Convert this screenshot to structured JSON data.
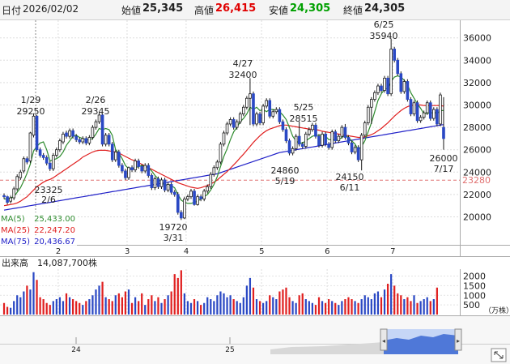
{
  "header": {
    "date_label": "日付",
    "date": "2026/02/02",
    "open_label": "始値",
    "open": "25,345",
    "high_label": "高値",
    "high": "26,415",
    "low_label": "安値",
    "low": "24,305",
    "close_label": "終値",
    "close": "24,305"
  },
  "colors": {
    "up": "#2a48c4",
    "down": "#2a48c4",
    "ma5": "#2e8b2e",
    "ma25": "#e02020",
    "ma75": "#2020c8",
    "vol_up": "#2a48c4",
    "vol_down": "#e02020",
    "high_value": "#e00000",
    "low_value": "#00a000",
    "ref_line": "#e07070"
  },
  "legend": {
    "ma5": "MA(5)",
    "ma5_value": "25,433.00",
    "ma25": "MA(25)",
    "ma25_value": "22,247.20",
    "ma75": "MA(75)",
    "ma75_value": "20,436.67"
  },
  "volume_header": {
    "label": "出来高",
    "value": "14,087,700株"
  },
  "volume_unit": "（万株）",
  "ref_price_label": "23280",
  "nav_labels": [
    "24",
    "25"
  ],
  "chart_data": {
    "type": "candlestick",
    "x_month_labels": [
      "2",
      "3",
      "4",
      "5",
      "6",
      "7"
    ],
    "price_axis": {
      "ylim": [
        17500,
        37500
      ],
      "ticks": [
        20000,
        22000,
        24000,
        26000,
        28000,
        30000,
        32000,
        34000,
        36000
      ]
    },
    "volume_axis": {
      "ylim": [
        0,
        2400
      ],
      "ticks": [
        500,
        1000,
        1500,
        2000
      ]
    },
    "reference_price": 23280,
    "annotations": [
      {
        "date": "1/29",
        "value": 29250
      },
      {
        "date": "2/6",
        "value": 23325
      },
      {
        "date": "2/26",
        "value": 29345
      },
      {
        "date": "3/31",
        "value": 19720
      },
      {
        "date": "4/27",
        "value": 32400
      },
      {
        "date": "5/19",
        "value": 24860
      },
      {
        "date": "5/25",
        "value": 28515
      },
      {
        "date": "6/11",
        "value": 24150
      },
      {
        "date": "6/25",
        "value": 35940
      },
      {
        "date": "7/17",
        "value": 26000
      }
    ],
    "month_boundaries": [
      17,
      38,
      56,
      79,
      99,
      119
    ],
    "closes": [
      21800,
      21300,
      21700,
      22500,
      23600,
      24000,
      25200,
      24900,
      27500,
      29000,
      26000,
      25500,
      25300,
      24800,
      24300,
      25500,
      26000,
      26800,
      27400,
      27200,
      27700,
      27200,
      26900,
      26700,
      27000,
      26600,
      27100,
      28000,
      28500,
      29100,
      26500,
      27300,
      26500,
      25100,
      25800,
      24600,
      24100,
      23500,
      24400,
      24200,
      25000,
      24500,
      24100,
      24600,
      23700,
      22600,
      23400,
      22700,
      23300,
      22400,
      22900,
      22200,
      22000,
      20400,
      19900,
      21600,
      21800,
      22300,
      21100,
      21800,
      21600,
      22300,
      22700,
      23800,
      24400,
      24900,
      26500,
      27500,
      28300,
      28700,
      28000,
      28500,
      29200,
      29800,
      30600,
      31000,
      28300,
      29200,
      28400,
      29900,
      30400,
      29000,
      29400,
      29600,
      28500,
      27800,
      26800,
      25700,
      26100,
      27200,
      26500,
      26300,
      27400,
      27800,
      28200,
      27200,
      26400,
      27400,
      26500,
      26200,
      27600,
      26800,
      27200,
      28000,
      27100,
      26600,
      25800,
      26200,
      25100,
      27300,
      28400,
      29800,
      30500,
      31100,
      31700,
      31300,
      32400,
      31000,
      35000,
      34000,
      32800,
      31200,
      32100,
      30500,
      29200,
      30200,
      28600,
      28900,
      29300,
      30200,
      28800,
      29600,
      28300,
      30900,
      27000
    ],
    "opens": [
      21900,
      21800,
      21400,
      21700,
      22500,
      23500,
      24100,
      25200,
      25000,
      27300,
      29000,
      26000,
      25500,
      25300,
      24800,
      24300,
      25500,
      26000,
      26700,
      27500,
      27200,
      27700,
      27200,
      26900,
      26700,
      27000,
      26600,
      27100,
      28000,
      28500,
      29100,
      26500,
      27300,
      26500,
      25100,
      25800,
      24600,
      24100,
      23500,
      24400,
      24200,
      25000,
      24500,
      24100,
      24600,
      23700,
      22600,
      23400,
      22700,
      23300,
      22400,
      22900,
      22200,
      22000,
      20400,
      19900,
      21600,
      21800,
      22300,
      21100,
      21800,
      21600,
      22300,
      22700,
      23800,
      24400,
      24900,
      26500,
      27500,
      28300,
      28700,
      28000,
      28500,
      29200,
      29800,
      30600,
      31000,
      28300,
      29200,
      28400,
      29900,
      30400,
      29000,
      29400,
      29600,
      28500,
      27800,
      26800,
      25700,
      26100,
      27200,
      26500,
      26300,
      27400,
      27800,
      28200,
      27200,
      26400,
      27400,
      26500,
      26200,
      27600,
      26800,
      27200,
      28000,
      27100,
      26600,
      25800,
      26200,
      25100,
      27300,
      28400,
      29800,
      30500,
      31100,
      31700,
      31300,
      32400,
      31000,
      35000,
      34000,
      32800,
      31200,
      32100,
      30500,
      29200,
      30200,
      28600,
      28900,
      29300,
      30200,
      28800,
      29600,
      28300,
      28000
    ],
    "highs": [
      22100,
      21900,
      21900,
      22700,
      23800,
      24200,
      25400,
      25400,
      27600,
      29250,
      29100,
      26200,
      25700,
      25500,
      25000,
      25700,
      26200,
      27000,
      27600,
      27700,
      27900,
      27900,
      27400,
      27100,
      27200,
      27200,
      27300,
      28200,
      28700,
      29345,
      29200,
      27500,
      27500,
      26700,
      26000,
      26000,
      24800,
      24300,
      24500,
      24600,
      25200,
      25200,
      24700,
      24800,
      24800,
      23900,
      23600,
      23600,
      23500,
      23500,
      23100,
      23100,
      22400,
      22200,
      20600,
      21800,
      22000,
      22500,
      22500,
      22000,
      22000,
      22500,
      22900,
      24000,
      24600,
      25100,
      26700,
      27700,
      28500,
      28900,
      28900,
      28700,
      29400,
      30000,
      30800,
      32400,
      31200,
      29400,
      29400,
      30100,
      30600,
      30600,
      29600,
      29800,
      29800,
      28700,
      28000,
      27000,
      26300,
      27400,
      28515,
      26700,
      27600,
      28000,
      28400,
      28400,
      27400,
      27600,
      27600,
      26700,
      27800,
      27800,
      27400,
      28200,
      28300,
      27300,
      26800,
      26400,
      26400,
      27500,
      28600,
      30000,
      30700,
      31300,
      31900,
      31900,
      32600,
      32600,
      35940,
      35200,
      34200,
      33000,
      32300,
      32300,
      30700,
      30400,
      30400,
      29100,
      29500,
      30400,
      30400,
      29800,
      29800,
      31100,
      30700
    ],
    "lows": [
      21600,
      21100,
      21200,
      21500,
      22300,
      23300,
      23900,
      24700,
      24800,
      27100,
      25800,
      25300,
      25100,
      24600,
      24100,
      24100,
      25300,
      25800,
      26500,
      27000,
      27000,
      27000,
      26700,
      26500,
      26500,
      26400,
      26400,
      26900,
      27800,
      28300,
      26300,
      26300,
      26300,
      24900,
      24900,
      24400,
      23900,
      23300,
      23300,
      24000,
      24000,
      24300,
      23900,
      23900,
      23500,
      22400,
      22400,
      22500,
      22500,
      22200,
      22200,
      22000,
      21800,
      20200,
      19720,
      19800,
      21400,
      21600,
      21000,
      21000,
      21400,
      21400,
      22100,
      22500,
      23600,
      24200,
      24700,
      26300,
      27300,
      28100,
      27800,
      27800,
      28300,
      29000,
      29600,
      28200,
      28100,
      28100,
      28200,
      28200,
      29700,
      28800,
      28800,
      29200,
      28300,
      27600,
      26600,
      25500,
      25500,
      25900,
      26300,
      26100,
      26100,
      27200,
      27600,
      27000,
      26200,
      26200,
      26300,
      26000,
      26000,
      26600,
      26600,
      27000,
      26900,
      26400,
      25600,
      25600,
      24900,
      24150,
      27100,
      28200,
      28300,
      30300,
      30900,
      31100,
      31100,
      30800,
      30800,
      33800,
      32600,
      31000,
      31000,
      30300,
      29000,
      29000,
      28400,
      28400,
      28700,
      29100,
      28600,
      28600,
      28100,
      28100,
      26000
    ],
    "volumes": [
      600,
      400,
      350,
      700,
      1000,
      900,
      1200,
      1500,
      1300,
      2200,
      1800,
      900,
      800,
      600,
      500,
      700,
      800,
      900,
      700,
      1100,
      900,
      800,
      700,
      600,
      500,
      700,
      800,
      1000,
      1300,
      1500,
      1700,
      900,
      800,
      700,
      1000,
      1100,
      900,
      1200,
      1300,
      600,
      900,
      700,
      1100,
      500,
      800,
      1000,
      700,
      900,
      600,
      800,
      1000,
      1200,
      2100,
      1900,
      2300,
      1100,
      700,
      600,
      800,
      700,
      500,
      600,
      900,
      800,
      700,
      1000,
      1200,
      1100,
      900,
      1000,
      800,
      700,
      600,
      900,
      1500,
      1900,
      1400,
      800,
      700,
      600,
      700,
      1000,
      900,
      800,
      1200,
      1300,
      1400,
      900,
      700,
      600,
      1000,
      1100,
      800,
      700,
      600,
      500,
      900,
      700,
      600,
      800,
      700,
      600,
      500,
      700,
      800,
      900,
      800,
      700,
      600,
      800,
      1000,
      900,
      800,
      1100,
      1200,
      900,
      1300,
      1600,
      2100,
      1500,
      1100,
      1000,
      800,
      900,
      700,
      1000,
      600,
      700,
      800,
      900,
      700,
      800,
      1400
    ],
    "ma5": [
      21600,
      21600,
      21700,
      21800,
      22200,
      22600,
      23200,
      23900,
      24700,
      25900,
      26300,
      26600,
      26700,
      26000,
      25000,
      25100,
      25200,
      25400,
      25800,
      26400,
      26800,
      27200,
      27300,
      27100,
      27000,
      26900,
      26900,
      27000,
      27400,
      27900,
      27800,
      27900,
      27800,
      27300,
      26000,
      25700,
      25200,
      24600,
      24300,
      24300,
      24400,
      24500,
      24600,
      24500,
      24400,
      24100,
      23700,
      23400,
      23100,
      22800,
      22900,
      22800,
      22600,
      22000,
      21500,
      21300,
      21200,
      21200,
      21300,
      21400,
      21600,
      21800,
      22000,
      22400,
      22900,
      23600,
      24500,
      25400,
      26100,
      26900,
      27600,
      28000,
      28500,
      28800,
      29200,
      29800,
      29600,
      29800,
      29500,
      29600,
      29400,
      29600,
      29600,
      29500,
      29400,
      29100,
      28700,
      28000,
      27200,
      26800,
      26600,
      26600,
      26800,
      27000,
      27200,
      27300,
      27300,
      27300,
      27200,
      26900,
      26900,
      26900,
      26900,
      27100,
      27300,
      27100,
      26800,
      26500,
      26000,
      26300,
      26800,
      27600,
      28400,
      29400,
      30400,
      31000,
      31400,
      31500,
      32100,
      32500,
      32600,
      32500,
      32200,
      31800,
      31100,
      30600,
      30100,
      29700,
      29200,
      29300,
      29200,
      29400,
      29200,
      29500,
      29500
    ],
    "ma25": [
      21000,
      21050,
      21100,
      21150,
      21250,
      21400,
      21600,
      21800,
      22100,
      22400,
      22700,
      22900,
      23100,
      23250,
      23350,
      23500,
      23700,
      23900,
      24100,
      24300,
      24500,
      24700,
      24900,
      25100,
      25350,
      25500,
      25650,
      25800,
      25900,
      25950,
      25950,
      25950,
      25900,
      25850,
      25800,
      25700,
      25550,
      25400,
      25250,
      25100,
      25000,
      24850,
      24700,
      24550,
      24400,
      24250,
      24100,
      23950,
      23800,
      23650,
      23500,
      23350,
      23200,
      23050,
      22950,
      22850,
      22750,
      22650,
      22600,
      22550,
      22600,
      22700,
      22800,
      22950,
      23100,
      23300,
      23550,
      23800,
      24050,
      24350,
      24650,
      24950,
      25300,
      25600,
      25950,
      26300,
      26650,
      26950,
      27250,
      27500,
      27700,
      27850,
      27950,
      28050,
      28150,
      28200,
      28200,
      28150,
      28100,
      28050,
      28000,
      27950,
      27900,
      27850,
      27850,
      27800,
      27750,
      27650,
      27600,
      27550,
      27500,
      27450,
      27400,
      27350,
      27300,
      27250,
      27200,
      27150,
      27100,
      27100,
      27150,
      27250,
      27350,
      27500,
      27700,
      27900,
      28150,
      28400,
      28700,
      29000,
      29250,
      29500,
      29700,
      29850,
      29950,
      30000,
      30000,
      30000,
      29950,
      29950,
      29950,
      29950,
      29950,
      29950,
      29900
    ],
    "ma75": [
      20600,
      20650,
      20700,
      20750,
      20800,
      20850,
      20900,
      20950,
      21000,
      21050,
      21100,
      21150,
      21200,
      21250,
      21300,
      21350,
      21400,
      21450,
      21500,
      21550,
      21600,
      21650,
      21700,
      21750,
      21800,
      21850,
      21900,
      21950,
      22000,
      22050,
      22100,
      22150,
      22200,
      22250,
      22300,
      22350,
      22400,
      22450,
      22500,
      22550,
      22600,
      22650,
      22700,
      22750,
      22800,
      22850,
      22900,
      22950,
      23000,
      23050,
      23100,
      23150,
      23200,
      23250,
      23300,
      23350,
      23400,
      23450,
      23500,
      23550,
      23600,
      23650,
      23700,
      23750,
      23800,
      23850,
      23950,
      24050,
      24150,
      24250,
      24350,
      24450,
      24550,
      24650,
      24750,
      24850,
      24950,
      25050,
      25150,
      25250,
      25350,
      25450,
      25550,
      25650,
      25750,
      25800,
      25850,
      25900,
      25950,
      26000,
      26050,
      26100,
      26150,
      26200,
      26250,
      26300,
      26350,
      26400,
      26450,
      26500,
      26550,
      26600,
      26650,
      26700,
      26750,
      26800,
      26850,
      26900,
      26950,
      27000,
      27050,
      27100,
      27150,
      27200,
      27250,
      27300,
      27350,
      27400,
      27450,
      27500,
      27550,
      27600,
      27650,
      27700,
      27750,
      27800,
      27850,
      27900,
      27950,
      28000,
      28050,
      28100,
      28150,
      28200,
      28250
    ]
  }
}
